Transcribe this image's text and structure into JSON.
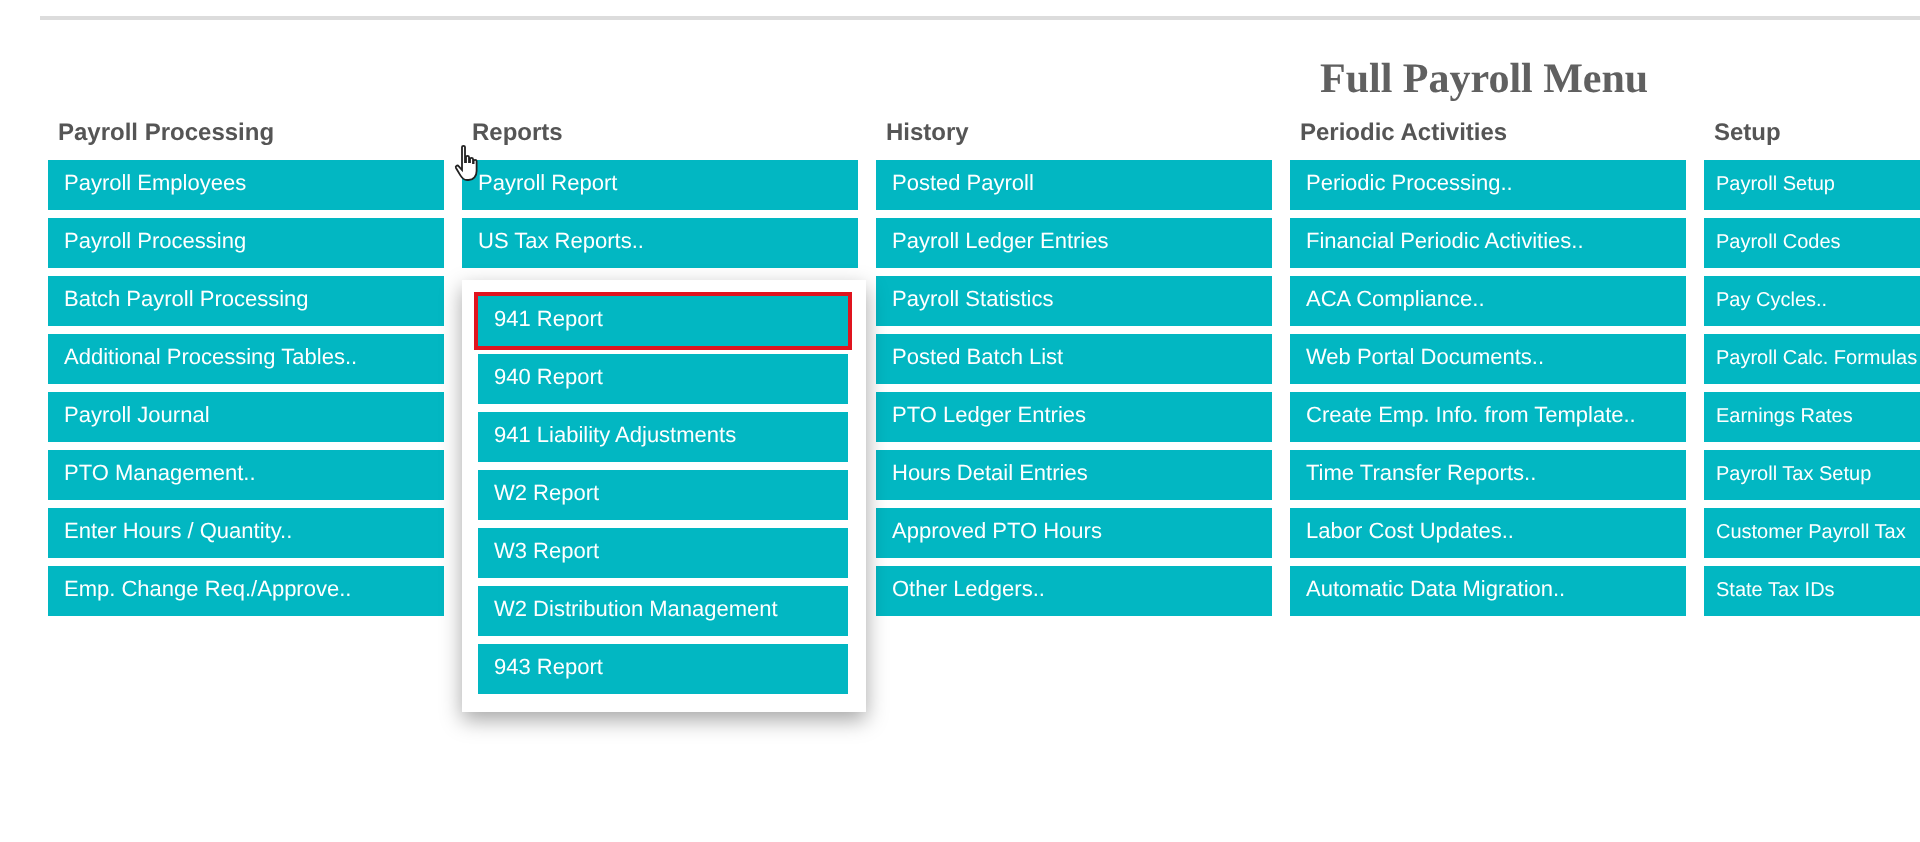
{
  "title": "Full Payroll Menu",
  "columns": [
    {
      "heading": "Payroll Processing",
      "items": [
        {
          "label": "Payroll Employees"
        },
        {
          "label": "Payroll Processing"
        },
        {
          "label": "Batch Payroll Processing"
        },
        {
          "label": "Additional Processing Tables.."
        },
        {
          "label": "Payroll Journal"
        },
        {
          "label": "PTO Management.."
        },
        {
          "label": "Enter Hours / Quantity.."
        },
        {
          "label": "Emp. Change Req./Approve.."
        }
      ]
    },
    {
      "heading": "Reports",
      "items": [
        {
          "label": "Payroll Report"
        },
        {
          "label": "US Tax Reports..",
          "expanded": true,
          "submenu": [
            {
              "label": "941 Report",
              "selected": true
            },
            {
              "label": "940 Report",
              "selected": false
            },
            {
              "label": "941 Liability Adjustments",
              "selected": false
            },
            {
              "label": "W2 Report",
              "selected": false
            },
            {
              "label": "W3 Report",
              "selected": false
            },
            {
              "label": "W2 Distribution Management",
              "selected": false
            },
            {
              "label": "943 Report",
              "selected": false
            }
          ]
        }
      ]
    },
    {
      "heading": "History",
      "items": [
        {
          "label": "Posted Payroll"
        },
        {
          "label": "Payroll Ledger Entries"
        },
        {
          "label": "Payroll Statistics"
        },
        {
          "label": "Posted Batch List"
        },
        {
          "label": "PTO Ledger Entries"
        },
        {
          "label": "Hours Detail Entries"
        },
        {
          "label": "Approved PTO Hours"
        },
        {
          "label": "Other Ledgers.."
        }
      ]
    },
    {
      "heading": "Periodic Activities",
      "items": [
        {
          "label": "Periodic Processing.."
        },
        {
          "label": "Financial Periodic Activities.."
        },
        {
          "label": "ACA Compliance.."
        },
        {
          "label": "Web Portal Documents.."
        },
        {
          "label": "Create Emp. Info. from Template.."
        },
        {
          "label": "Time Transfer Reports.."
        },
        {
          "label": "Labor Cost Updates.."
        },
        {
          "label": "Automatic Data Migration.."
        }
      ]
    },
    {
      "heading": "Setup",
      "items": [
        {
          "label": "Payroll Setup"
        },
        {
          "label": "Payroll Codes"
        },
        {
          "label": "Pay Cycles.."
        },
        {
          "label": "Payroll Calc. Formulas"
        },
        {
          "label": "Earnings Rates"
        },
        {
          "label": "Payroll Tax Setup"
        },
        {
          "label": "Customer Payroll Tax"
        },
        {
          "label": "State Tax IDs"
        }
      ]
    }
  ]
}
